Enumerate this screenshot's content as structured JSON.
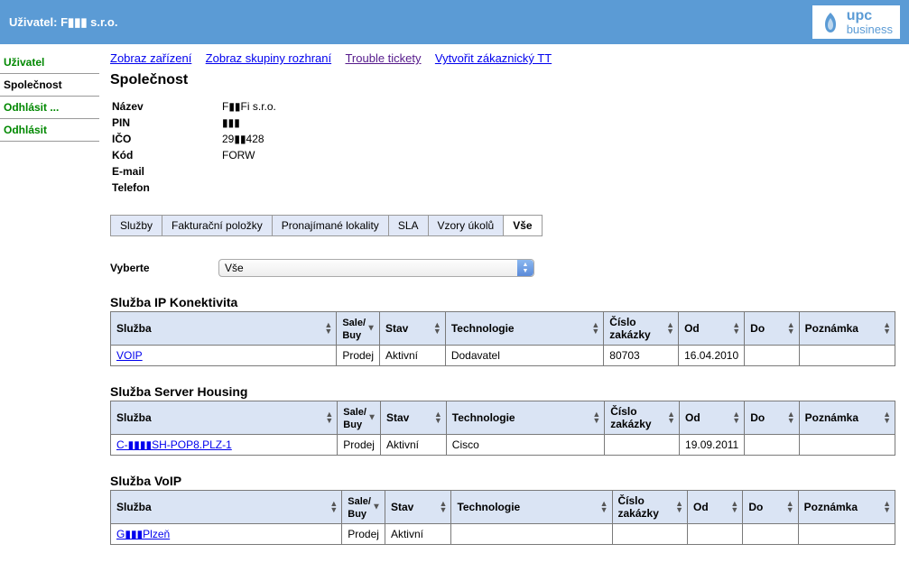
{
  "header": {
    "user_label": "Uživatel:",
    "user_value": "F▮▮▮ s.r.o.",
    "logo_line1": "upc",
    "logo_line2": "business"
  },
  "sidebar": {
    "items": [
      {
        "label": "Uživatel"
      },
      {
        "label": "Společnost"
      },
      {
        "label": "Odhlásit ..."
      },
      {
        "label": "Odhlásit"
      }
    ]
  },
  "topLinks": [
    {
      "label": "Zobraz zařízení"
    },
    {
      "label": "Zobraz skupiny rozhraní"
    },
    {
      "label": "Trouble tickety"
    },
    {
      "label": "Vytvořit zákaznický TT"
    }
  ],
  "pageTitle": "Společnost",
  "info": {
    "rows": [
      {
        "label": "Název",
        "value": "F▮▮Fi s.r.o."
      },
      {
        "label": "PIN",
        "value": "▮▮▮"
      },
      {
        "label": "IČO",
        "value": "29▮▮428"
      },
      {
        "label": "Kód",
        "value": "FORW"
      },
      {
        "label": "E-mail",
        "value": ""
      },
      {
        "label": "Telefon",
        "value": ""
      }
    ]
  },
  "tabs": [
    {
      "label": "Služby"
    },
    {
      "label": "Fakturační položky"
    },
    {
      "label": "Pronajímané lokality"
    },
    {
      "label": "SLA"
    },
    {
      "label": "Vzory úkolů"
    },
    {
      "label": "Vše"
    }
  ],
  "select": {
    "label": "Vyberte",
    "value": "Vše"
  },
  "columns": {
    "sluzba": "Služba",
    "sale1": "Sale/",
    "sale2": "Buy",
    "stav": "Stav",
    "technologie": "Technologie",
    "zakazka": "Číslo zakázky",
    "od": "Od",
    "do": "Do",
    "poznamka": "Poznámka"
  },
  "sections": [
    {
      "title": "Služba IP Konektivita",
      "rows": [
        {
          "sluzba": "VOIP",
          "sale": "Prodej",
          "stav": "Aktivní",
          "tech": "Dodavatel",
          "zakazka": "80703",
          "od": "16.04.2010",
          "do": "",
          "pozn": ""
        }
      ]
    },
    {
      "title": "Služba Server Housing",
      "rows": [
        {
          "sluzba": "C-▮▮▮▮SH-POP8.PLZ-1",
          "sale": "Prodej",
          "stav": "Aktivní",
          "tech": "Cisco",
          "zakazka": "",
          "od": "19.09.2011",
          "do": "",
          "pozn": ""
        }
      ]
    },
    {
      "title": "Služba VoIP",
      "rows": [
        {
          "sluzba": "G▮▮▮Plzeň",
          "sale": "Prodej",
          "stav": "Aktivní",
          "tech": "",
          "zakazka": "",
          "od": "",
          "do": "",
          "pozn": ""
        }
      ]
    }
  ]
}
